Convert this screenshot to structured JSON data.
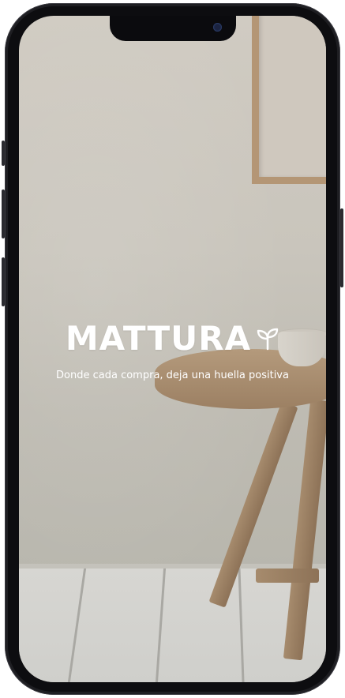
{
  "brand": {
    "name": "MATTURA",
    "tagline": "Donde cada compra, deja una huella positiva",
    "icon": "sprout-icon"
  },
  "colors": {
    "text": "#ffffff",
    "wall": "#c9c5bc",
    "wood": "#a68b6d",
    "device": "#1e1e22"
  }
}
